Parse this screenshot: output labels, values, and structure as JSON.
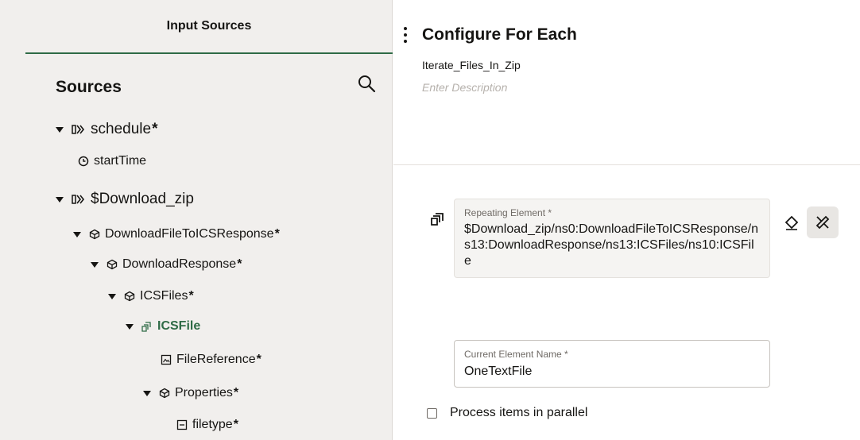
{
  "left_panel": {
    "tab_label": "Input Sources",
    "sources_title": "Sources",
    "tree": [
      {
        "label": "schedule",
        "required": "*"
      },
      {
        "label": "startTime",
        "required": ""
      },
      {
        "label": "$Download_zip",
        "required": ""
      },
      {
        "label": "DownloadFileToICSResponse",
        "required": "*"
      },
      {
        "label": "DownloadResponse",
        "required": "*"
      },
      {
        "label": "ICSFiles",
        "required": "*"
      },
      {
        "label": "ICSFile",
        "required": ""
      },
      {
        "label": "FileReference",
        "required": "*"
      },
      {
        "label": "Properties",
        "required": "*"
      },
      {
        "label": "filetype",
        "required": "*"
      }
    ]
  },
  "right_panel": {
    "title": "Configure For Each",
    "name": "Iterate_Files_In_Zip",
    "description_placeholder": "Enter Description",
    "repeating_element": {
      "label": "Repeating Element *",
      "value": "$Download_zip/ns0:DownloadFileToICSResponse/ns13:DownloadResponse/ns13:ICSFiles/ns10:ICSFile"
    },
    "current_element": {
      "label": "Current Element Name *",
      "value": "OneTextFile"
    },
    "parallel_label": "Process items in parallel"
  },
  "colors": {
    "panel_bg": "#f1efed",
    "accent_green": "#2f6b46",
    "text": "#161513"
  }
}
